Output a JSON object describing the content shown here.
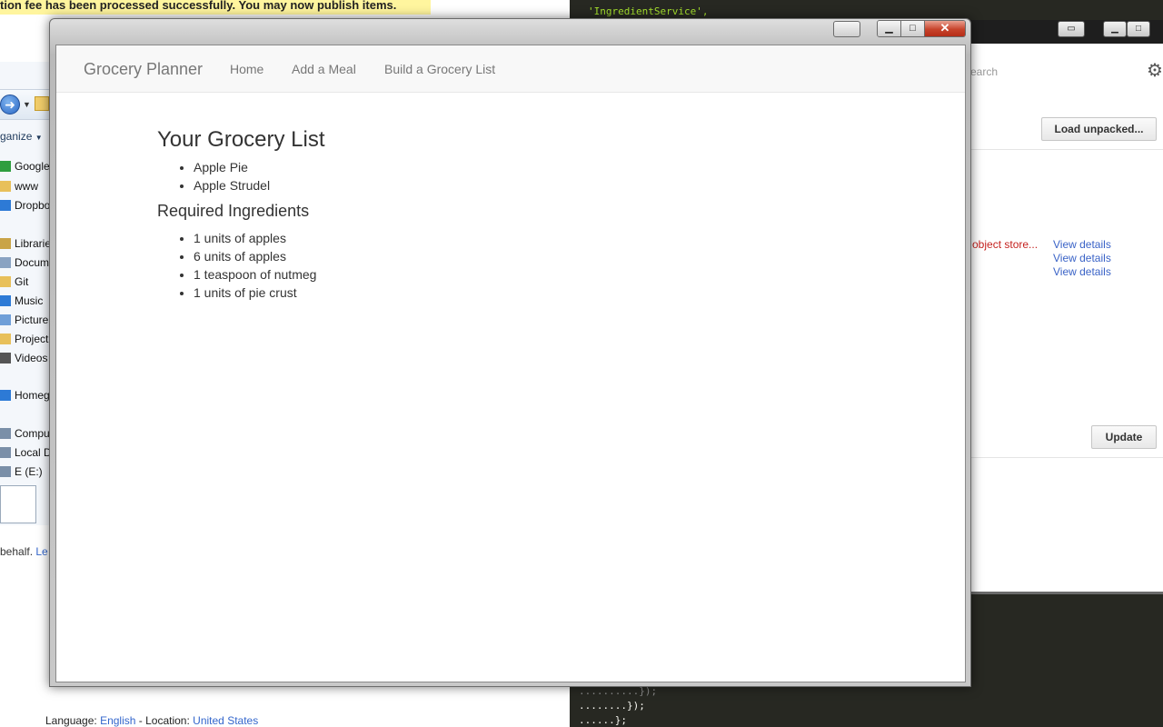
{
  "background_page": {
    "banner_text": "tion fee has been processed successfully. You may now publish items.",
    "behalf_text": "behalf.",
    "behalf_link": "Le",
    "language_label": "Language:",
    "language_value": "English",
    "location_label": "- Location:",
    "location_value": "United States"
  },
  "explorer": {
    "organize_label": "ganize",
    "tree": [
      {
        "label": "Google",
        "icon": "checkmark-icon",
        "color": "#2e9e3f"
      },
      {
        "label": "www",
        "icon": "folder-icon",
        "color": "#e8c05a"
      },
      {
        "label": "Dropbo",
        "icon": "dropbox-icon",
        "color": "#2d7ad6"
      },
      {
        "label": "Libraries",
        "icon": "library-icon",
        "color": "#c9a447"
      },
      {
        "label": "Docum",
        "icon": "documents-icon",
        "color": "#8aa3c2"
      },
      {
        "label": "Git",
        "icon": "folder-icon",
        "color": "#e8c05a"
      },
      {
        "label": "Music",
        "icon": "music-icon",
        "color": "#2d7ad6"
      },
      {
        "label": "Picture",
        "icon": "pictures-icon",
        "color": "#6f9fd8"
      },
      {
        "label": "Project",
        "icon": "folder-icon",
        "color": "#e8c05a"
      },
      {
        "label": "Videos",
        "icon": "videos-icon",
        "color": "#555555"
      },
      {
        "label": "Homegr",
        "icon": "homegroup-icon",
        "color": "#2d7ad6"
      },
      {
        "label": "Compute",
        "icon": "computer-icon",
        "color": "#7a8fa8"
      },
      {
        "label": "Local D",
        "icon": "drive-icon",
        "color": "#7a8fa8"
      },
      {
        "label": "E (E:)",
        "icon": "drive-icon",
        "color": "#7a8fa8"
      }
    ]
  },
  "editor": {
    "code_top": "'IngredientService',",
    "code_bot1": "..........});",
    "code_bot2": "........});",
    "code_bot3": "......};"
  },
  "extensions": {
    "search_placeholder": "earch",
    "load_unpacked_label": "Load unpacked...",
    "error_text": "d object store...",
    "links": [
      "View details",
      "View details",
      "View details"
    ],
    "update_label": "Update"
  },
  "app": {
    "brand": "Grocery Planner",
    "nav": [
      {
        "label": "Home"
      },
      {
        "label": "Add a Meal"
      },
      {
        "label": "Build a Grocery List"
      }
    ],
    "list_title": "Your Grocery List",
    "meals": [
      "Apple Pie",
      "Apple Strudel"
    ],
    "ingredients_title": "Required Ingredients",
    "ingredients": [
      "1 units of apples",
      "6 units of apples",
      "1 teaspoon of nutmeg",
      "1 units of pie crust"
    ]
  },
  "colors": {
    "banner": "#fff59e",
    "editor_bg": "#272822",
    "close_button": "#c7432b",
    "link_blue": "#3a63c7",
    "error_red": "#c5221f"
  }
}
